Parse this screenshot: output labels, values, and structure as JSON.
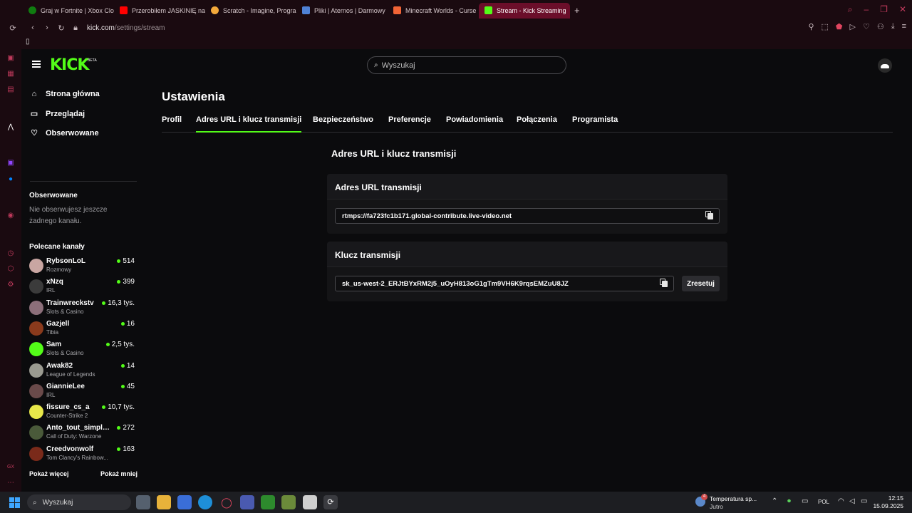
{
  "browser": {
    "tabs": [
      {
        "label": "Graj w Fortnite | Xbox Clo",
        "color": "#107c10"
      },
      {
        "label": "Przerobiłem JASKINIĘ na",
        "color": "#ff0000"
      },
      {
        "label": "Scratch - Imagine, Progra",
        "color": "#f3a93b"
      },
      {
        "label": "Pliki | Aternos | Darmowy",
        "color": "#4f82d6"
      },
      {
        "label": "Minecraft Worlds - Curse",
        "color": "#f16436"
      },
      {
        "label": "Stream - Kick Streaming",
        "color": "#53fc18"
      }
    ],
    "url_host": "kick.com",
    "url_path": "/settings/stream"
  },
  "header": {
    "logo": "KICK",
    "logo_badge": "BETA",
    "search_placeholder": "Wyszukaj"
  },
  "nav": {
    "home": "Strona główna",
    "browse": "Przeglądaj",
    "following": "Obserwowane"
  },
  "sidebar": {
    "followed_title": "Obserwowane",
    "followed_empty": "Nie obserwujesz jeszcze żadnego kanału.",
    "recommended_title": "Polecane kanały",
    "channels": [
      {
        "name": "RybsonLoL",
        "category": "Rozmowy",
        "viewers": "514",
        "avatar_color": "#c9a6a2"
      },
      {
        "name": "xNzq",
        "category": "IRL",
        "viewers": "399",
        "avatar_color": "#3b3b3b"
      },
      {
        "name": "Trainwreckstv",
        "category": "Slots & Casino",
        "viewers": "16,3 tys.",
        "avatar_color": "#8c6f7a"
      },
      {
        "name": "Gazjell",
        "category": "Tibia",
        "viewers": "16",
        "avatar_color": "#8a3a1c"
      },
      {
        "name": "Sam",
        "category": "Slots & Casino",
        "viewers": "2,5 tys.",
        "avatar_color": "#53fc18"
      },
      {
        "name": "Awak82",
        "category": "League of Legends",
        "viewers": "14",
        "avatar_color": "#9a9a90"
      },
      {
        "name": "GiannieLee",
        "category": "IRL",
        "viewers": "45",
        "avatar_color": "#6a4a4a"
      },
      {
        "name": "fissure_cs_a",
        "category": "Counter-Strike 2",
        "viewers": "10,7 tys.",
        "avatar_color": "#e8e84a"
      },
      {
        "name": "Anto_tout_simple...",
        "category": "Call of Duty: Warzone",
        "viewers": "272",
        "avatar_color": "#4a5a3a"
      },
      {
        "name": "Creedvonwolf",
        "category": "Tom Clancy's Rainbow...",
        "viewers": "163",
        "avatar_color": "#7a2a1a"
      }
    ],
    "show_more": "Pokaż więcej",
    "show_less": "Pokaż mniej"
  },
  "settings": {
    "title": "Ustawienia",
    "tabs": [
      "Profil",
      "Adres URL i klucz transmisji",
      "Bezpieczeństwo",
      "Preferencje",
      "Powiadomienia",
      "Połączenia",
      "Programista"
    ],
    "section_heading": "Adres URL i klucz transmisji",
    "url_card_title": "Adres URL transmisji",
    "url_value": "rtmps://fa723fc1b171.global-contribute.live-video.net",
    "key_card_title": "Klucz transmisji",
    "key_value": "sk_us-west-2_ERJtBYxRM2j5_uOyH813oG1gTm9VH6K9rqsEMZuU8JZ",
    "reset_label": "Zresetuj"
  },
  "taskbar": {
    "search_placeholder": "Wyszukaj",
    "weather_badge": "4",
    "weather_line1": "Temperatura sp...",
    "weather_line2": "Jutro",
    "language": "POL",
    "time": "12:15",
    "date": "15.09.2025"
  },
  "colors": {
    "accent": "#53fc18",
    "opera": "#c03a5c"
  }
}
